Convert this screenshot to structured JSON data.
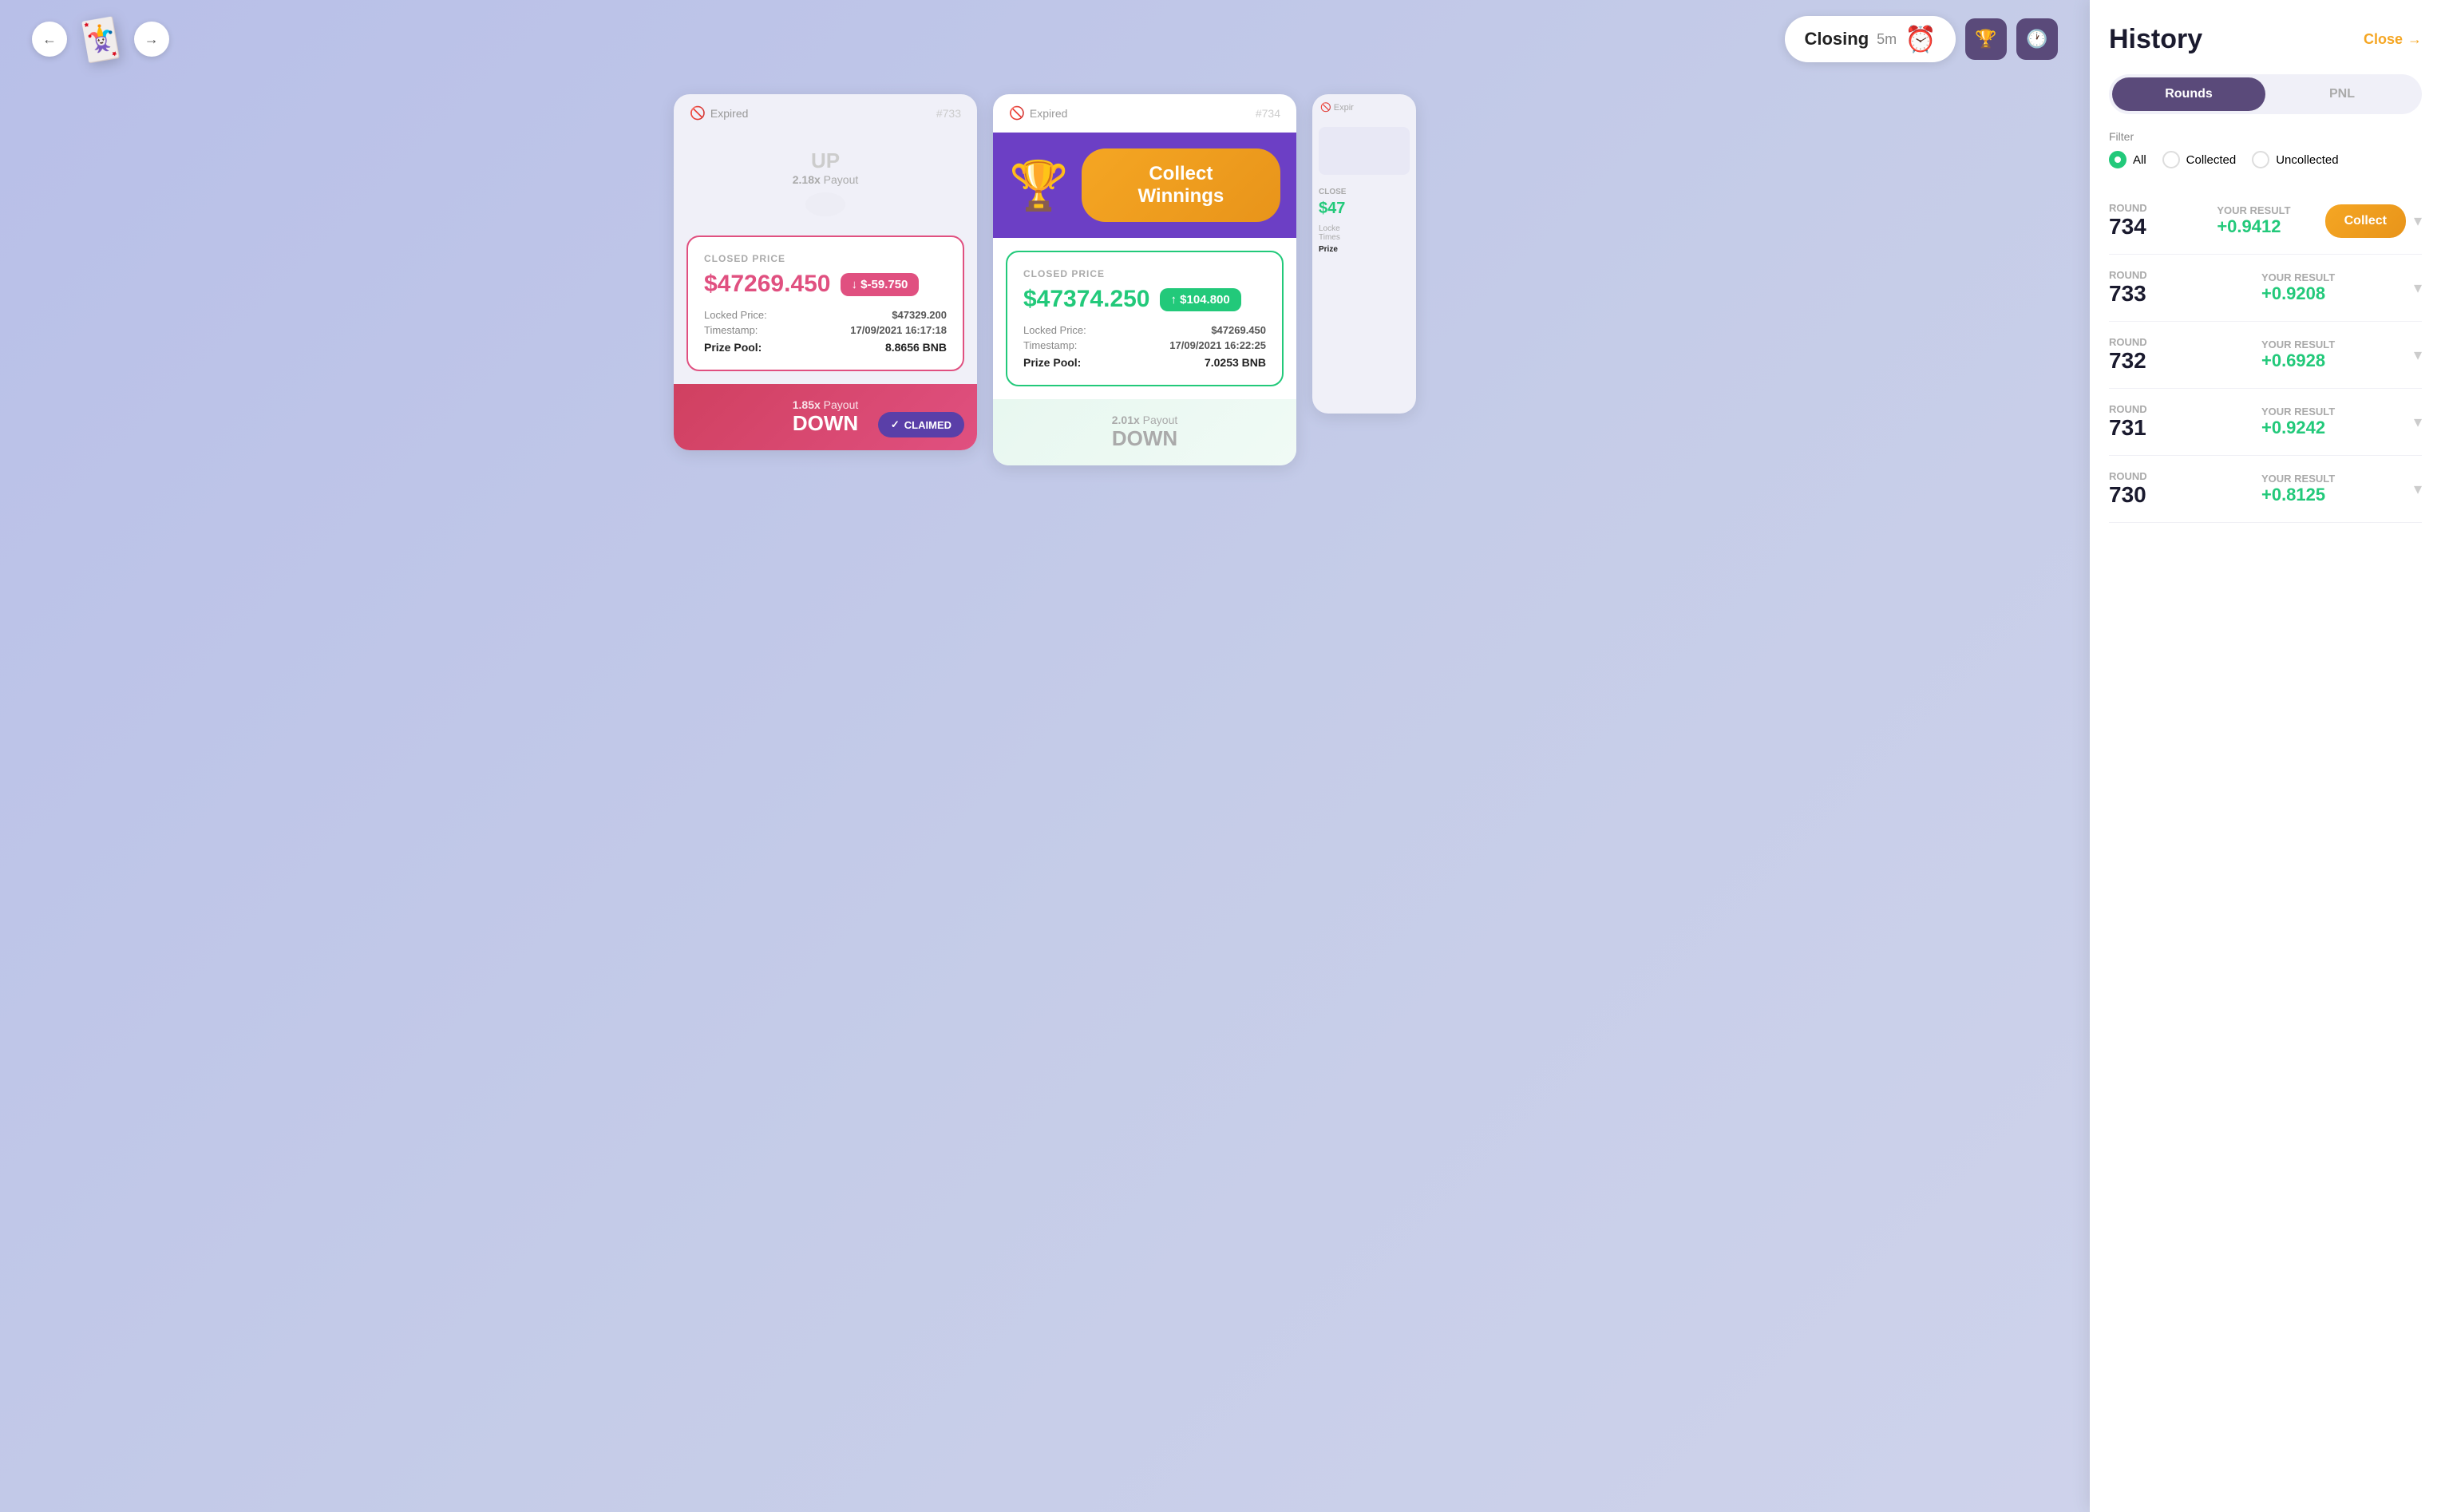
{
  "history": {
    "title": "History",
    "close_label": "Close",
    "tabs": [
      {
        "id": "rounds",
        "label": "Rounds",
        "active": true
      },
      {
        "id": "pnl",
        "label": "PNL",
        "active": false
      }
    ],
    "filter": {
      "label": "Filter",
      "options": [
        {
          "id": "all",
          "label": "All",
          "selected": true
        },
        {
          "id": "collected",
          "label": "Collected",
          "selected": false
        },
        {
          "id": "uncollected",
          "label": "Uncollected",
          "selected": false
        }
      ]
    },
    "rows": [
      {
        "round_label": "Round",
        "round_number": "734",
        "result_label": "Your Result",
        "result_value": "+0.9412",
        "action": "collect",
        "action_label": "Collect"
      },
      {
        "round_label": "Round",
        "round_number": "733",
        "result_label": "Your Result",
        "result_value": "+0.9208",
        "action": "none"
      },
      {
        "round_label": "Round",
        "round_number": "732",
        "result_label": "Your Result",
        "result_value": "+0.6928",
        "action": "none"
      },
      {
        "round_label": "Round",
        "round_number": "731",
        "result_label": "Your Result",
        "result_value": "+0.9242",
        "action": "none"
      },
      {
        "round_label": "Round",
        "round_number": "730",
        "result_label": "Your Result",
        "result_value": "+0.8125",
        "action": "none"
      }
    ]
  },
  "nav": {
    "prev_label": "←",
    "next_label": "→",
    "card_emoji": "🃏"
  },
  "closing_bar": {
    "status_label": "Closing",
    "timer_value": "5m",
    "timer_icon": "⏰"
  },
  "cards": {
    "card1": {
      "status": "Expired",
      "round": "#733",
      "up_label": "UP",
      "up_payout": "2.18x Payout",
      "closed_price_label": "CLOSED PRICE",
      "main_price": "$47269.450",
      "price_diff": "↓ $-59.750",
      "locked_price_label": "Locked Price:",
      "locked_price": "$47329.200",
      "timestamp_label": "Timestamp:",
      "timestamp": "17/09/2021 16:17:18",
      "prize_pool_label": "Prize Pool:",
      "prize_pool": "8.8656 BNB",
      "down_payout": "1.85x Payout",
      "down_label": "DOWN",
      "claimed_label": "CLAIMED"
    },
    "card2": {
      "status": "Expired",
      "round": "#734",
      "collect_winnings_label": "Collect Winnings",
      "closed_price_label": "CLOSED PRICE",
      "main_price": "$47374.250",
      "price_diff": "↑ $104.800",
      "locked_price_label": "Locked Price:",
      "locked_price": "$47269.450",
      "timestamp_label": "Timestamp:",
      "timestamp": "17/09/2021 16:22:25",
      "prize_pool_label": "Prize Pool:",
      "prize_pool": "7.0253 BNB",
      "down_payout": "2.01x Payout",
      "down_label": "DOWN"
    },
    "card3": {
      "status": "Expir",
      "closed_price_label": "CLOSE",
      "main_price": "$47",
      "locked_price_label": "Locke",
      "timestamp_label": "Times",
      "prize_pool_label": "Prize"
    }
  }
}
